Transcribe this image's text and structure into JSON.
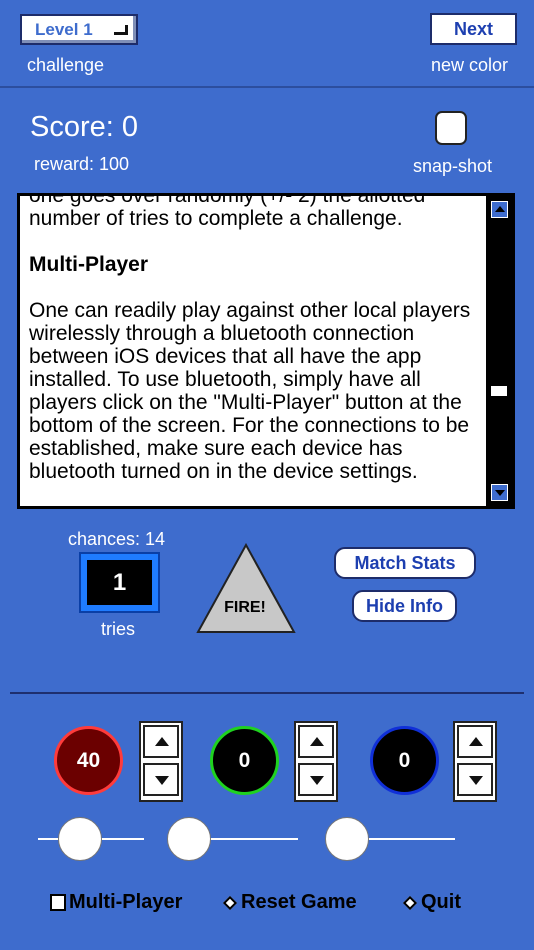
{
  "top": {
    "level_label": "Level 1",
    "challenge_label": "challenge",
    "next_label": "Next",
    "new_color_label": "new color"
  },
  "score": {
    "score_text": "Score: 0",
    "reward_text": "reward: 100",
    "snap_shot_label": "snap-shot"
  },
  "info": {
    "paragraph_1": "one goes over randomly (+/- 2) the allotted number of tries to complete a challenge.",
    "heading": "Multi-Player",
    "paragraph_2": "One can readily play against other local players wirelessly through a bluetooth connection between iOS devices that all have the app installed. To use bluetooth, simply have all players click on the \"Multi-Player\" button at the bottom of the screen. For the connections to be established, make sure each device has bluetooth turned on in the device settings."
  },
  "controls": {
    "chances_text": "chances: 14",
    "tries_value": "1",
    "tries_label": "tries",
    "fire_label": "FIRE!",
    "match_stats_label": "Match Stats",
    "hide_info_label": "Hide Info"
  },
  "colors": {
    "red": {
      "value": "40",
      "fill": "#6b0000",
      "ring": "#ff3b3b"
    },
    "green": {
      "value": "0",
      "fill": "#000000",
      "ring": "#1fd21f"
    },
    "blue": {
      "value": "0",
      "fill": "#000000",
      "ring": "#1030d8"
    }
  },
  "bottom": {
    "multi_player_label": "Multi-Player",
    "reset_game_label": "Reset Game",
    "quit_label": "Quit"
  }
}
